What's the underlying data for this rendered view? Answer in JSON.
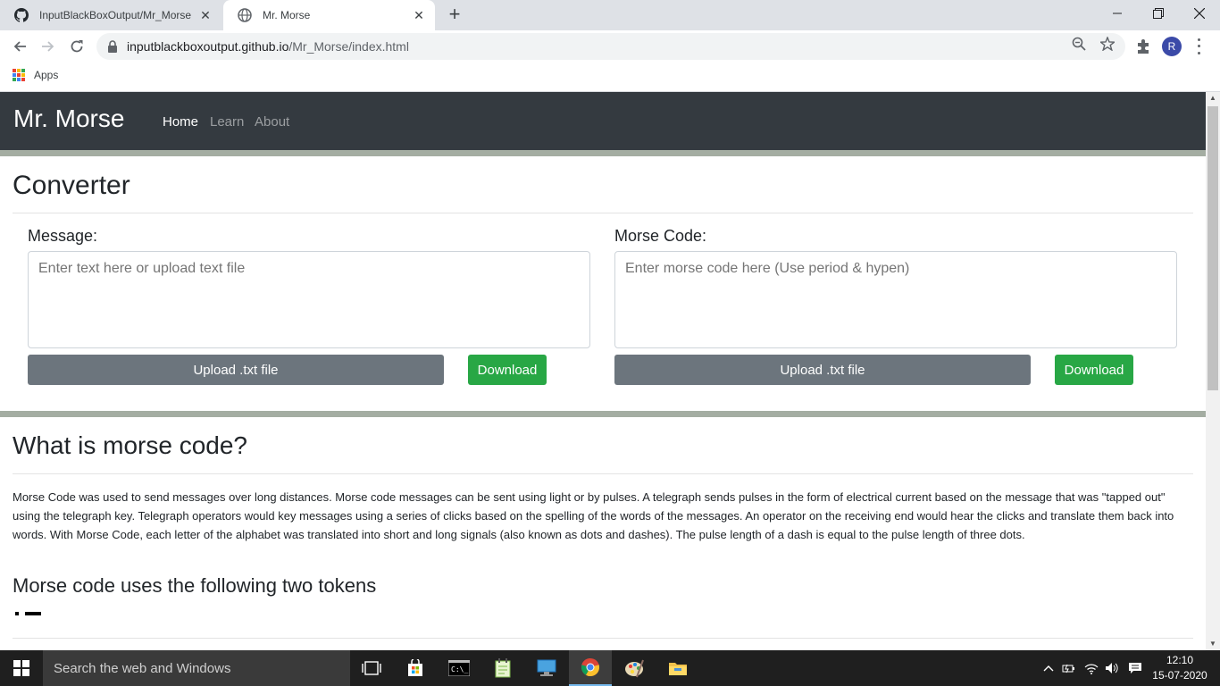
{
  "browser": {
    "tabs": [
      {
        "title": "InputBlackBoxOutput/Mr_Morse:",
        "icon": "github-icon"
      },
      {
        "title": "Mr. Morse",
        "icon": "globe-icon"
      }
    ],
    "url_host": "inputblackboxoutput.github.io",
    "url_path": "/Mr_Morse/index.html",
    "profile_initial": "R",
    "bookmarks": {
      "apps_label": "Apps"
    }
  },
  "site": {
    "brand": "Mr. Morse",
    "nav": [
      {
        "label": "Home",
        "active": true
      },
      {
        "label": "Learn",
        "active": false
      },
      {
        "label": "About",
        "active": false
      }
    ]
  },
  "converter": {
    "title": "Converter",
    "message": {
      "label": "Message:",
      "placeholder": "Enter text here or upload text file",
      "upload_label": "Upload .txt file",
      "download_label": "Download"
    },
    "morse": {
      "label": "Morse Code:",
      "placeholder": "Enter morse code here (Use period & hypen)",
      "upload_label": "Upload .txt file",
      "download_label": "Download"
    }
  },
  "about": {
    "title": "What is morse code?",
    "paragraph": "Morse Code was used to send messages over long distances. Morse code messages can be sent using light or by pulses. A telegraph sends pulses in the form of electrical current based on the message that was \"tapped out\" using the telegraph key. Telegraph operators would key messages using a series of clicks based on the spelling of the words of the messages. An operator on the receiving end would hear the clicks and translate them back into words. With Morse Code, each letter of the alphabet was translated into short and long signals (also known as dots and dashes). The pulse length of a dash is equal to the pulse length of three dots.",
    "tokens_title": "Morse code uses the following two tokens"
  },
  "taskbar": {
    "search_placeholder": "Search the web and Windows",
    "time": "12:10",
    "date": "15-07-2020"
  },
  "colors": {
    "navbar_bg": "#343a40",
    "separator": "#a4ada2",
    "btn_secondary": "#6c757d",
    "btn_success": "#28a745",
    "profile_bg": "#3b4aa8"
  }
}
